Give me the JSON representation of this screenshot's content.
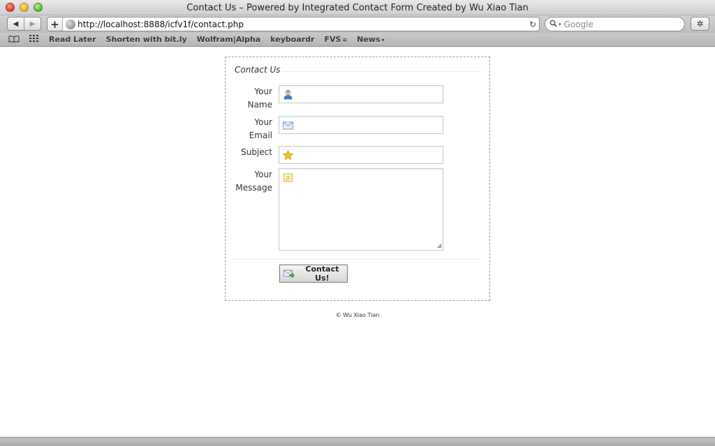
{
  "window": {
    "title": "Contact Us – Powered by Integrated Contact Form Created by Wu Xiao Tian"
  },
  "toolbar": {
    "back_glyph": "◀",
    "forward_glyph": "▶",
    "add_glyph": "+",
    "url": "http://localhost:8888/icfv1f/contact.php",
    "reload_glyph": "↻",
    "search_placeholder": "Google",
    "search_icon": "magnifier-icon",
    "bug_glyph": "✲"
  },
  "bookmarks": {
    "reading_list_glyph": "📖",
    "top_sites_glyph": "▦▦",
    "items": [
      {
        "label": "Read Later"
      },
      {
        "label": "Shorten with bit.ly"
      },
      {
        "label": "Wolfram|Alpha"
      },
      {
        "label": "keyboardr"
      },
      {
        "label": "FVS",
        "suffix": "≡"
      },
      {
        "label": "News",
        "suffix": "▾"
      }
    ]
  },
  "form": {
    "legend": "Contact Us",
    "fields": [
      {
        "label_line1": "Your",
        "label_line2": "Name",
        "icon": "user-icon",
        "value": ""
      },
      {
        "label_line1": "Your",
        "label_line2": "Email",
        "icon": "envelope-icon",
        "value": ""
      },
      {
        "label_line1": "Subject",
        "label_line2": "",
        "icon": "star-icon",
        "value": ""
      },
      {
        "label_line1": "Your",
        "label_line2": "Message",
        "icon": "note-icon",
        "value": ""
      }
    ],
    "submit_label": "Contact Us!",
    "submit_icon": "mail-arrow-icon"
  },
  "footer": {
    "text": "© Wu Xiao Tian"
  },
  "colors": {
    "fieldset_border": "#9b9b9b",
    "field_border": "#c8c8c8",
    "star": "#f2c320",
    "user_blue": "#4a78c8"
  }
}
